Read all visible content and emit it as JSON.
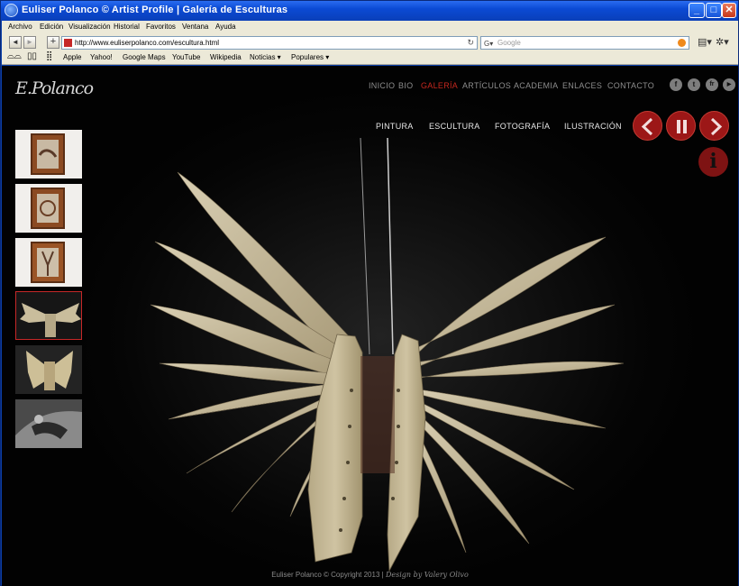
{
  "window": {
    "title": "Euliser Polanco © Artist Profile  |  Galería de Esculturas"
  },
  "menu": [
    "Archivo",
    "Edición",
    "Visualización",
    "Historial",
    "Favoritos",
    "Ventana",
    "Ayuda"
  ],
  "toolbar": {
    "back": "◄",
    "forward": "►",
    "add": "+",
    "url": "http://www.euliserpolanco.com/escultura.html",
    "search_placeholder": "Google",
    "reload_icon": "↻"
  },
  "bookmarks": [
    "Apple",
    "Yahoo!",
    "Google Maps",
    "YouTube",
    "Wikipedia",
    "Noticias ▾",
    "Populares ▾"
  ],
  "site": {
    "logo": "E.Polanco",
    "nav": [
      {
        "label": "INICIO",
        "active": false
      },
      {
        "label": "BIO",
        "active": false
      },
      {
        "label": "GALERÍA",
        "active": true
      },
      {
        "label": "ARTÍCULOS",
        "active": false
      },
      {
        "label": "ACADEMIA",
        "active": false
      },
      {
        "label": "ENLACES",
        "active": false
      },
      {
        "label": "CONTACTO",
        "active": false
      }
    ],
    "social": [
      {
        "name": "facebook-icon",
        "glyph": "f"
      },
      {
        "name": "twitter-icon",
        "glyph": "t"
      },
      {
        "name": "flickr-icon",
        "glyph": "fr"
      },
      {
        "name": "youtube-icon",
        "glyph": "▶"
      }
    ],
    "subnav": [
      "PINTURA",
      "ESCULTURA",
      "FOTOGRAFÍA",
      "ILUSTRACIÓN"
    ],
    "info_label": "i",
    "accent_color": "#c4271e",
    "thumbnails": [
      {
        "name": "thumb-box-sculpture-1",
        "selected": false
      },
      {
        "name": "thumb-box-sculpture-2",
        "selected": false
      },
      {
        "name": "thumb-box-sculpture-3",
        "selected": false
      },
      {
        "name": "thumb-wings-dark",
        "selected": true
      },
      {
        "name": "thumb-wings-light",
        "selected": false
      },
      {
        "name": "thumb-figure-bw",
        "selected": false
      }
    ],
    "footer_copyright": "Euliser Polanco © Copyright 2013 | ",
    "footer_design": "Design by Valery Olivo"
  }
}
